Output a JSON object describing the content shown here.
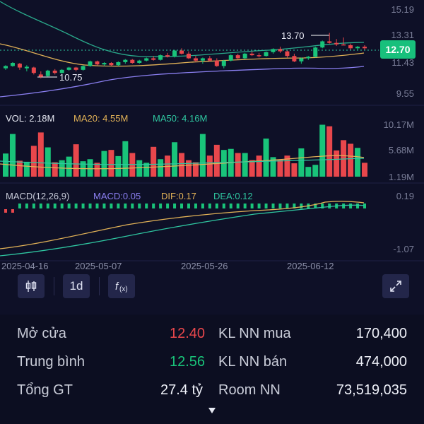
{
  "colors": {
    "up": "#19c47a",
    "down": "#e8474c",
    "ma20": "#e2b257",
    "ma50": "#2fc7a1",
    "macd": "#8a7ff0",
    "background": "#0e1027",
    "price_badge": "#18c07c"
  },
  "price_axis": {
    "ticks": [
      "15.19",
      "13.31",
      "11.43",
      "9.55"
    ],
    "current_price": "12.70",
    "high_marker": "13.70",
    "low_marker": "10.75"
  },
  "volume_panel": {
    "vol_label": "VOL: 2.18M",
    "ma20_label": "MA20: 4.55M",
    "ma50_label": "MA50: 4.16M",
    "ticks": [
      "10.17M",
      "5.68M",
      "1.19M"
    ]
  },
  "macd_panel": {
    "title": "MACD(12,26,9)",
    "macd_label": "MACD:0.05",
    "dif_label": "DIF:0.17",
    "dea_label": "DEA:0.12",
    "ticks": [
      "0.19",
      "-1.07"
    ]
  },
  "x_axis": {
    "dates": [
      "2025-04-16",
      "2025-05-07",
      "2025-05-26",
      "2025-06-12"
    ]
  },
  "toolbar": {
    "candle_icon": "candlestick-icon",
    "interval": "1d",
    "function_icon": "function-icon",
    "expand_icon": "expand-icon"
  },
  "stats": {
    "open": {
      "label": "Mở cửa",
      "value": "12.40",
      "color": "#e8474c"
    },
    "average": {
      "label": "Trung bình",
      "value": "12.56",
      "color": "#19c47a"
    },
    "total_value": {
      "label": "Tổng GT",
      "value": "27.4 tỷ"
    },
    "foreign_buy": {
      "label": "KL NN mua",
      "value": "170,400"
    },
    "foreign_sell": {
      "label": "KL NN bán",
      "value": "474,000"
    },
    "foreign_room": {
      "label": "Room NN",
      "value": "73,519,035"
    },
    "more_icon": "caret-down-icon"
  },
  "chart_data": {
    "type": "candlestick",
    "x_labels": [
      "2025-04-16",
      "2025-05-07",
      "2025-05-26",
      "2025-06-12"
    ],
    "ohlc": [
      [
        11.4,
        11.6,
        11.3,
        11.55
      ],
      [
        11.55,
        11.8,
        11.5,
        11.75
      ],
      [
        11.7,
        11.75,
        11.3,
        11.45
      ],
      [
        11.4,
        11.6,
        11.2,
        11.5
      ],
      [
        11.45,
        11.5,
        11.0,
        11.1
      ],
      [
        11.0,
        11.2,
        10.75,
        10.85
      ],
      [
        10.9,
        11.3,
        10.85,
        11.25
      ],
      [
        11.25,
        11.35,
        11.0,
        11.1
      ],
      [
        11.1,
        11.35,
        11.05,
        11.3
      ],
      [
        11.3,
        11.5,
        11.25,
        11.45
      ],
      [
        11.45,
        11.5,
        11.2,
        11.3
      ],
      [
        11.3,
        11.6,
        11.25,
        11.55
      ],
      [
        11.55,
        11.9,
        11.5,
        11.85
      ],
      [
        11.85,
        11.9,
        11.6,
        11.65
      ],
      [
        11.65,
        11.8,
        11.55,
        11.75
      ],
      [
        11.75,
        11.8,
        11.55,
        11.6
      ],
      [
        11.6,
        11.85,
        11.55,
        11.8
      ],
      [
        11.8,
        12.0,
        11.7,
        11.95
      ],
      [
        11.95,
        12.0,
        11.7,
        11.75
      ],
      [
        11.75,
        11.95,
        11.7,
        11.9
      ],
      [
        11.9,
        12.1,
        11.85,
        12.05
      ],
      [
        12.05,
        12.2,
        11.9,
        11.95
      ],
      [
        11.95,
        12.3,
        11.9,
        12.25
      ],
      [
        12.25,
        12.4,
        12.1,
        12.15
      ],
      [
        12.15,
        12.6,
        12.1,
        12.55
      ],
      [
        12.55,
        12.7,
        12.3,
        12.35
      ],
      [
        12.35,
        12.5,
        12.0,
        12.05
      ],
      [
        12.05,
        12.2,
        11.8,
        11.9
      ],
      [
        11.9,
        12.1,
        11.7,
        12.05
      ],
      [
        12.05,
        12.2,
        11.85,
        11.9
      ],
      [
        11.9,
        12.05,
        11.5,
        11.55
      ],
      [
        11.55,
        11.95,
        11.4,
        11.9
      ],
      [
        11.9,
        12.3,
        11.85,
        12.25
      ],
      [
        12.25,
        12.35,
        12.0,
        12.05
      ],
      [
        12.05,
        12.4,
        12.0,
        12.35
      ],
      [
        12.35,
        12.5,
        12.2,
        12.25
      ],
      [
        12.25,
        12.4,
        12.1,
        12.2
      ],
      [
        12.2,
        12.5,
        12.15,
        12.45
      ],
      [
        12.45,
        12.7,
        12.35,
        12.65
      ],
      [
        12.65,
        12.8,
        12.4,
        12.5
      ],
      [
        12.5,
        12.55,
        12.1,
        12.2
      ],
      [
        12.2,
        12.35,
        11.8,
        11.85
      ],
      [
        11.85,
        12.1,
        11.7,
        12.05
      ],
      [
        12.05,
        12.2,
        11.95,
        12.15
      ],
      [
        12.15,
        12.8,
        12.1,
        12.75
      ],
      [
        12.75,
        13.2,
        12.7,
        13.15
      ],
      [
        13.15,
        13.7,
        13.0,
        13.05
      ],
      [
        13.05,
        13.3,
        12.85,
        12.95
      ],
      [
        12.95,
        13.4,
        12.9,
        12.9
      ],
      [
        12.9,
        13.0,
        12.6,
        12.7
      ],
      [
        12.7,
        12.85,
        12.55,
        12.8
      ],
      [
        12.8,
        12.9,
        12.6,
        12.7
      ]
    ],
    "volume_millions": [
      4.5,
      8.3,
      3.1,
      2.9,
      6.0,
      8.6,
      5.7,
      2.8,
      3.2,
      3.9,
      6.3,
      3.0,
      3.4,
      2.7,
      5.0,
      5.2,
      4.0,
      6.9,
      4.6,
      3.2,
      2.7,
      5.8,
      3.4,
      4.1,
      6.7,
      4.6,
      3.2,
      2.8,
      8.3,
      4.1,
      6.2,
      5.2,
      5.4,
      4.6,
      4.6,
      3.2,
      4.1,
      7.4,
      3.8,
      3.3,
      4.1,
      2.6,
      5.5,
      1.9,
      2.3,
      10.1,
      9.8,
      5.1,
      7.1,
      6.4,
      5.6,
      2.7
    ],
    "ma20_ylim": [
      1.19,
      10.17
    ],
    "price_ylim": [
      9.55,
      15.19
    ],
    "macd_ylim": [
      -1.07,
      0.19
    ]
  }
}
